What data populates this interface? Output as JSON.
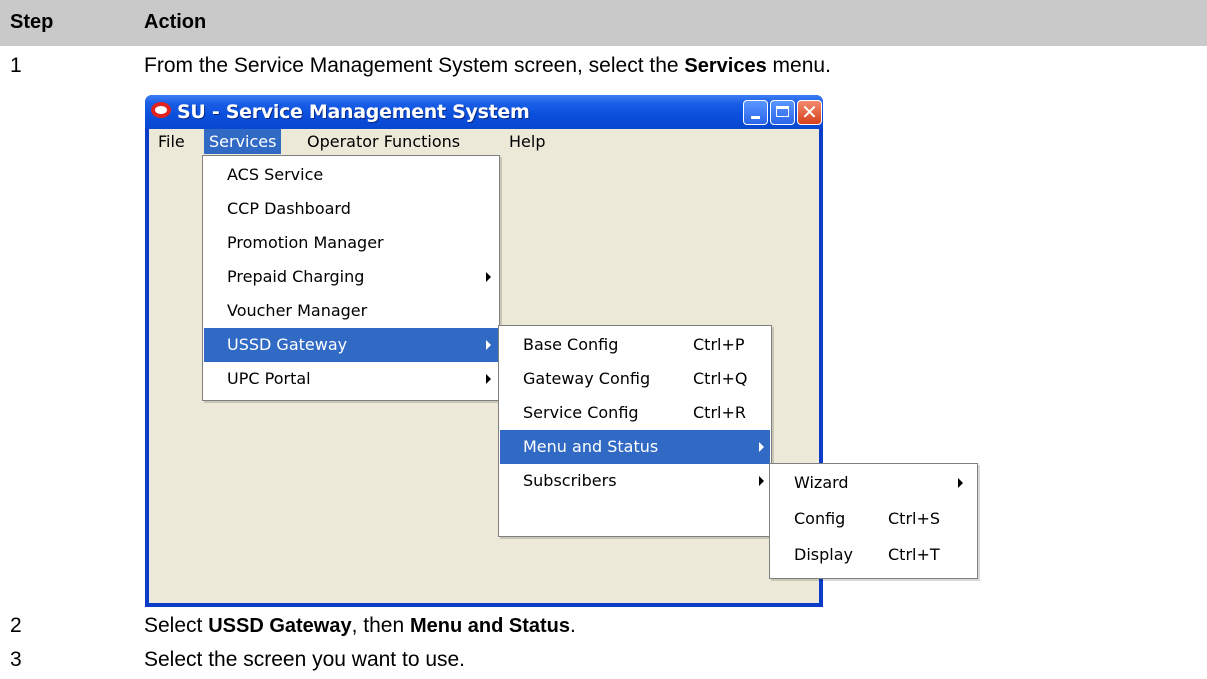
{
  "table": {
    "col_step": "Step",
    "col_action": "Action"
  },
  "steps": [
    {
      "num": "1",
      "pre": "From the Service Management System screen, select the ",
      "bold": "Services",
      "post": " menu."
    },
    {
      "num": "2",
      "pre": "Select ",
      "bold": "USSD Gateway",
      "mid": ", then ",
      "bold2": "Menu and Status",
      "post": "."
    },
    {
      "num": "3",
      "text": "Select the screen you want to use."
    }
  ],
  "window": {
    "title": "SU - Service Management System",
    "menubar": [
      "File",
      "Services",
      "Operator Functions",
      "Help"
    ],
    "active_menu": "Services"
  },
  "services_menu": [
    {
      "label": "ACS Service"
    },
    {
      "label": "CCP Dashboard"
    },
    {
      "label": "Promotion Manager"
    },
    {
      "label": "Prepaid Charging",
      "submenu": true
    },
    {
      "label": "Voucher Manager"
    },
    {
      "label": "USSD Gateway",
      "submenu": true,
      "highlighted": true
    },
    {
      "label": "UPC Portal",
      "submenu": true
    }
  ],
  "ussd_menu": [
    {
      "label": "Base Config",
      "shortcut": "Ctrl+P"
    },
    {
      "label": "Gateway Config",
      "shortcut": "Ctrl+Q"
    },
    {
      "label": "Service Config",
      "shortcut": "Ctrl+R"
    },
    {
      "label": "Menu and Status",
      "submenu": true,
      "highlighted": true
    },
    {
      "label": "Subscribers",
      "submenu": true
    }
  ],
  "status_menu": [
    {
      "label": "Wizard",
      "submenu": true
    },
    {
      "label": "Config",
      "shortcut": "Ctrl+S"
    },
    {
      "label": "Display",
      "shortcut": "Ctrl+T"
    }
  ],
  "colors": {
    "menu_highlight": "#316ac5",
    "window_face": "#ece9d8",
    "brand_red": "#e0231e"
  }
}
